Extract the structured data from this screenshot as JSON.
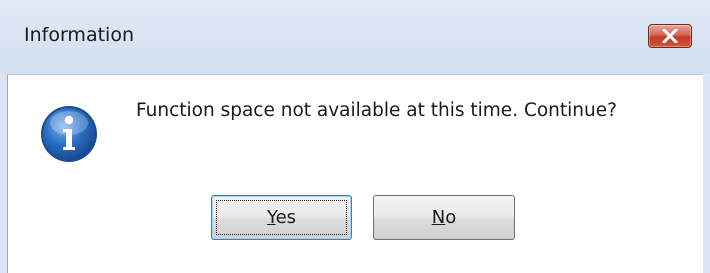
{
  "window": {
    "title": "Information",
    "close_icon": "close-icon"
  },
  "message": {
    "icon": "info-icon",
    "text": "Function space not available at this time. Continue?"
  },
  "buttons": {
    "yes": {
      "accel": "Y",
      "rest": "es"
    },
    "no": {
      "accel": "N",
      "rest": "o"
    }
  },
  "colors": {
    "titlebar": "#d3e0f1",
    "close_button": "#c23b23",
    "info_icon": "#2a6fc4",
    "focus_border": "#3c7fb1"
  }
}
